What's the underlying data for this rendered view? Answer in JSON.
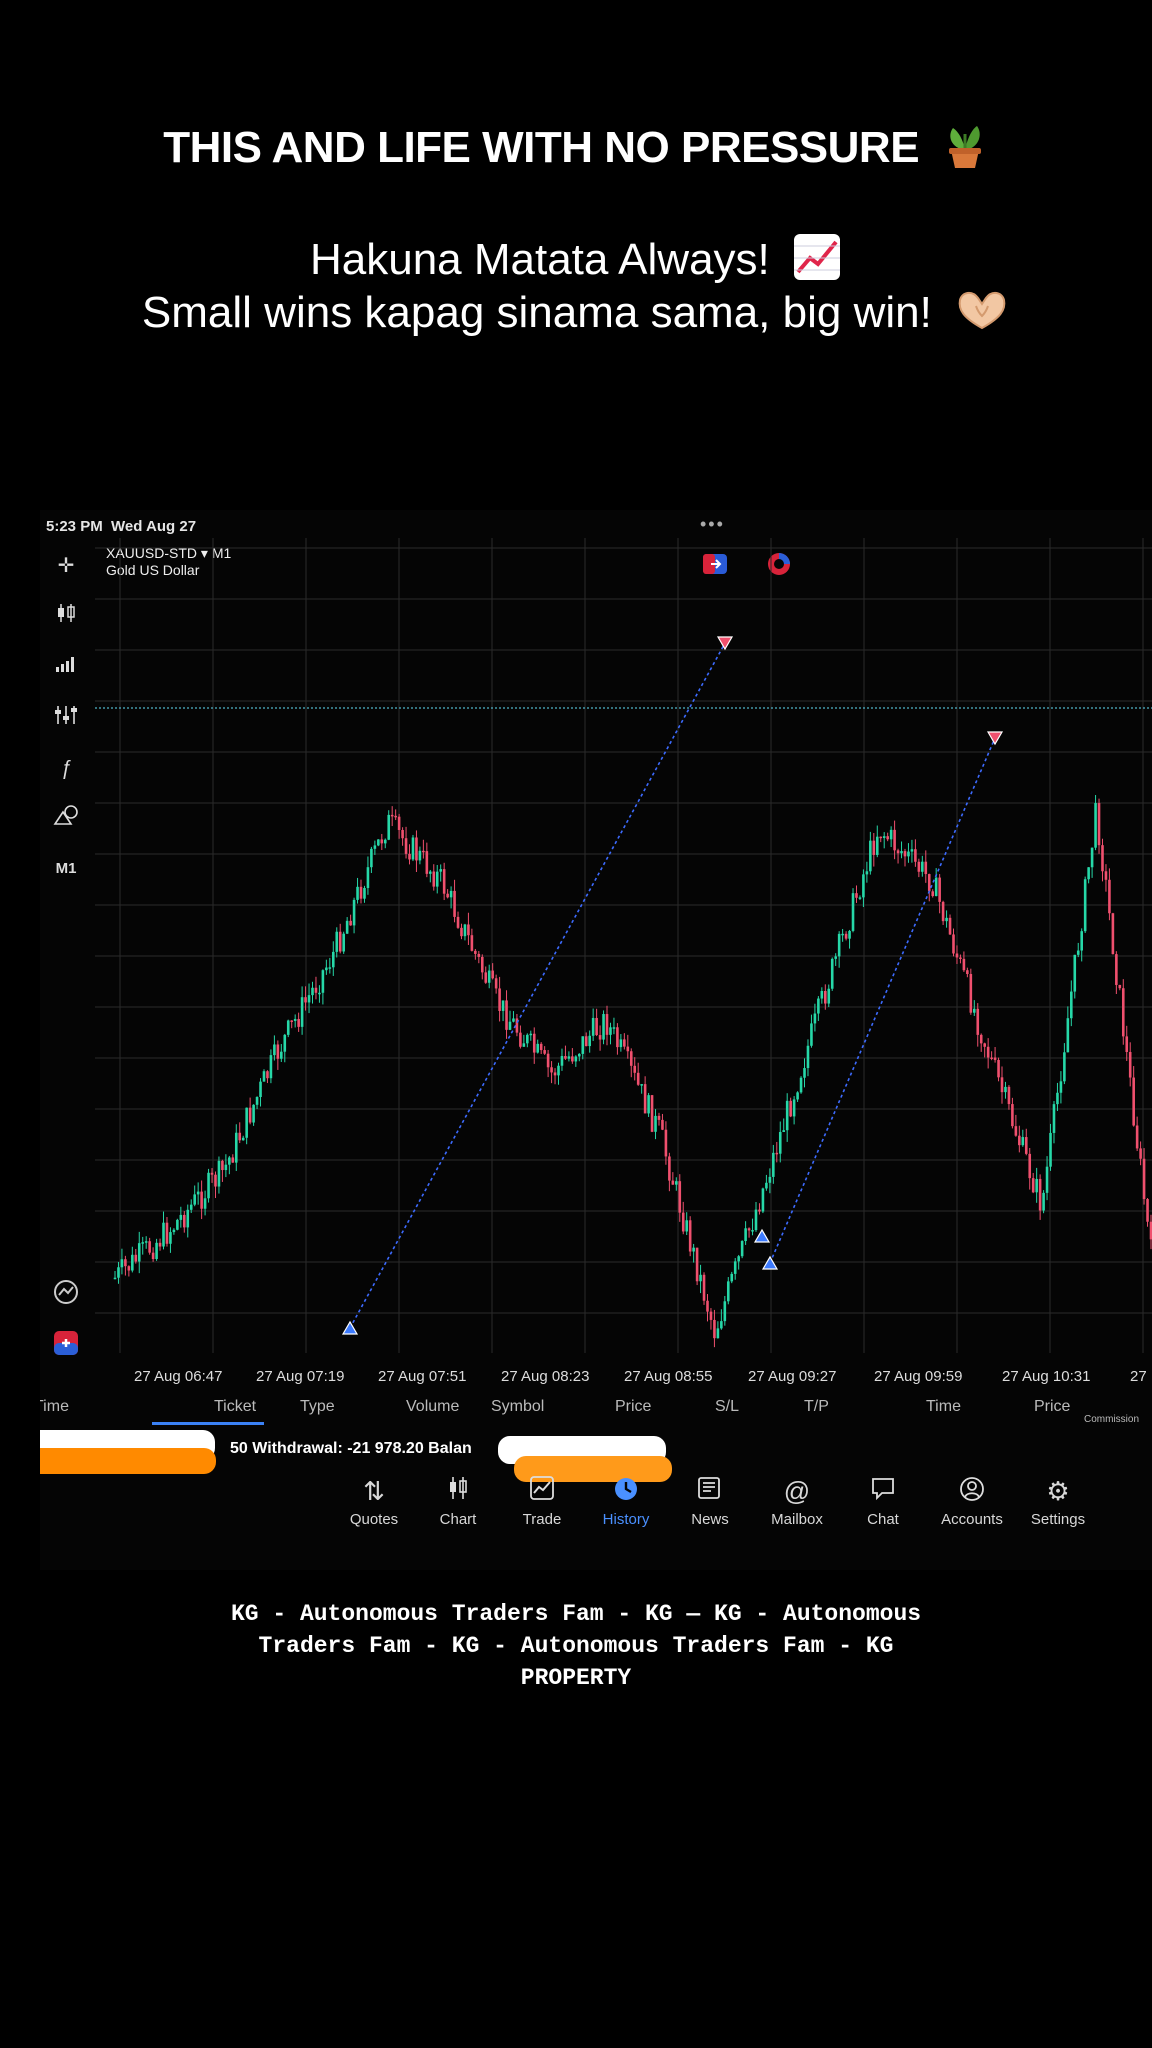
{
  "captions": {
    "line1": "THIS AND LIFE WITH NO PRESSURE",
    "line1_emoji": "potted-plant",
    "line2": "Hakuna Matata Always!",
    "line2_emoji": "chart-increasing",
    "line3": "Small wins kapag sinama sama, big win!",
    "line3_emoji": "heart-hands"
  },
  "status": {
    "time": "5:23 PM",
    "date": "Wed Aug 27"
  },
  "symbol": {
    "name": "XAUUSD-STD ▾ M1",
    "description": "Gold US Dollar"
  },
  "toolbar": {
    "timeframe": "M1"
  },
  "chart_data": {
    "type": "candlestick",
    "symbol": "XAUUSD-STD",
    "timeframe": "M1",
    "x_tick_labels": [
      "27 Aug 06:47",
      "27 Aug 07:19",
      "27 Aug 07:51",
      "27 Aug 08:23",
      "27 Aug 08:55",
      "27 Aug 09:27",
      "27 Aug 09:59",
      "27 Aug 10:31",
      "27"
    ],
    "path_shape": [
      0.9,
      0.82,
      0.72,
      0.52,
      0.36,
      0.14,
      0.24,
      0.44,
      0.56,
      0.47,
      0.66,
      0.99,
      0.72,
      0.43,
      0.15,
      0.24,
      0.52,
      0.78,
      0.12,
      0.86
    ],
    "colors": {
      "bull": "#26d8a8",
      "bear": "#f0506e",
      "grid": "#2a2a2a",
      "price_line": "#4fb3c8",
      "trade_line": "#3d6bff"
    }
  },
  "table_headers": [
    "Time",
    "Ticket",
    "Type",
    "Volume",
    "Symbol",
    "Price",
    "S/L",
    "T/P",
    "Time",
    "Price",
    "Commission"
  ],
  "history_row": {
    "text": "50 Withdrawal: -21 978.20 Balan"
  },
  "nav": [
    {
      "label": "Quotes",
      "icon": "arrows-updown-icon"
    },
    {
      "label": "Chart",
      "icon": "candles-icon"
    },
    {
      "label": "Trade",
      "icon": "trade-chart-icon"
    },
    {
      "label": "History",
      "icon": "history-clock-icon"
    },
    {
      "label": "News",
      "icon": "news-icon"
    },
    {
      "label": "Mailbox",
      "icon": "at-sign-icon"
    },
    {
      "label": "Chat",
      "icon": "chat-bubble-icon"
    },
    {
      "label": "Accounts",
      "icon": "account-icon"
    },
    {
      "label": "Settings",
      "icon": "gear-icon"
    }
  ],
  "watermark": {
    "line1": "KG - Autonomous Traders Fam - KG — KG - Autonomous",
    "line2": "Traders Fam - KG - Autonomous Traders Fam - KG",
    "line3": "PROPERTY"
  }
}
